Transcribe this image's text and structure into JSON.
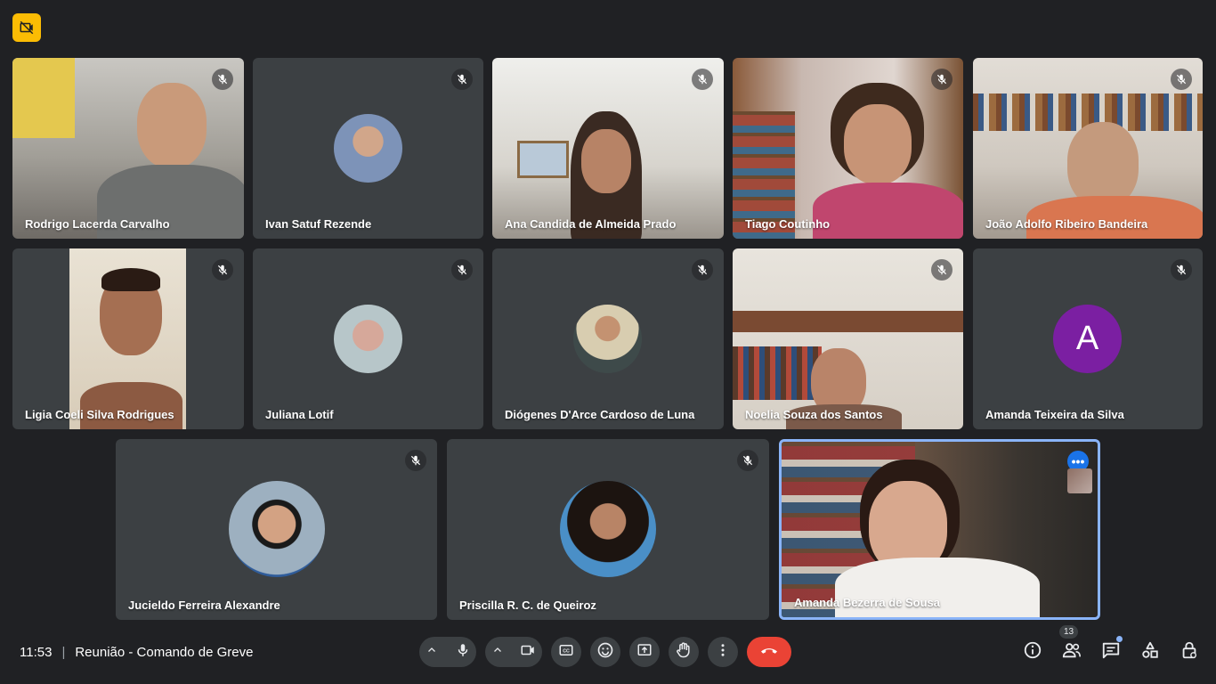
{
  "meeting": {
    "time": "11:53",
    "title": "Reunião - Comando de Greve"
  },
  "participants_count": "13",
  "participants": [
    {
      "name": "Rodrigo Lacerda Carvalho",
      "kind": "video",
      "bg": "#a9a69f"
    },
    {
      "name": "Ivan Satuf Rezende",
      "kind": "avatar",
      "bg": "#3c4043"
    },
    {
      "name": "Ana Candida de Almeida Prado",
      "kind": "video",
      "bg": "#d8d6d0"
    },
    {
      "name": "Tiago Coutinho",
      "kind": "video",
      "bg": "#c7a48f"
    },
    {
      "name": "João Adolfo Ribeiro Bandeira",
      "kind": "video",
      "bg": "#d9d4cc"
    },
    {
      "name": "Ligia Coeli Silva Rodrigues",
      "kind": "video",
      "bg": "#3c4043"
    },
    {
      "name": "Juliana Lotif",
      "kind": "avatar",
      "bg": "#3c4043"
    },
    {
      "name": "Diógenes D'Arce Cardoso de Luna",
      "kind": "avatar",
      "bg": "#3c4043"
    },
    {
      "name": "Noelia Souza dos Santos",
      "kind": "video",
      "bg": "#c9bfb5"
    },
    {
      "name": "Amanda Teixeira da Silva",
      "kind": "letter",
      "letter": "A",
      "bg": "#3c4043"
    },
    {
      "name": "Jucieldo Ferreira Alexandre",
      "kind": "avatar",
      "bg": "#3c4043"
    },
    {
      "name": "Priscilla R. C. de Queiroz",
      "kind": "avatar",
      "bg": "#3c4043"
    },
    {
      "name": "Amanda Bezerra de Sousa",
      "kind": "video",
      "bg": "#3f3a36"
    }
  ],
  "icons": {
    "recording": "recording-off-icon",
    "mic_off": "mic-off-icon",
    "more": "more-options-icon",
    "controls": [
      "chevron-up-icon",
      "mic-icon",
      "chevron-up-icon",
      "camera-icon",
      "captions-icon",
      "emoji-icon",
      "present-icon",
      "raise-hand-icon",
      "more-vert-icon",
      "end-call-icon"
    ],
    "right": [
      "info-icon",
      "people-icon",
      "chat-icon",
      "activities-icon",
      "host-controls-icon"
    ]
  },
  "colors": {
    "background": "#202124",
    "tile": "#3c4043",
    "end_call": "#ea4335",
    "active_border": "#8ab4f8",
    "rec_badge": "#fbbc04",
    "letter_avatar": "#7b1fa2"
  }
}
